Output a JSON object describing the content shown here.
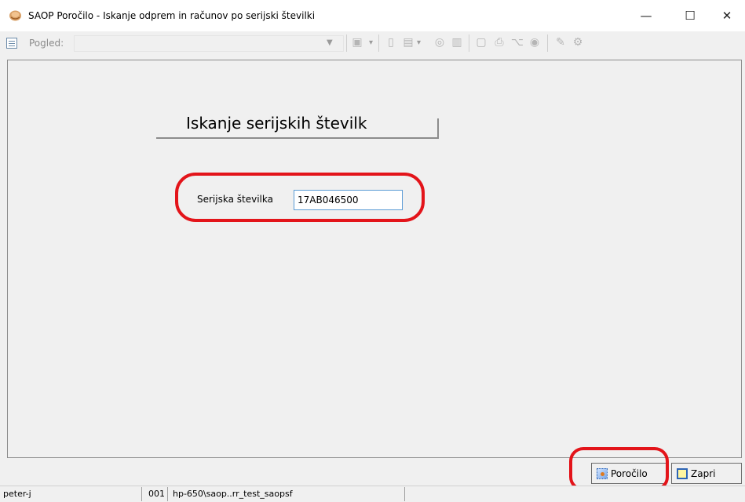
{
  "window": {
    "title": "SAOP Poročilo - Iskanje odprem in računov po serijski številki",
    "minimize": "—",
    "maximize": "☐",
    "close": "✕"
  },
  "toolbar": {
    "view_label": "Pogled:",
    "view_value": "",
    "icons": [
      "save-icon",
      "new-doc-icon",
      "export-icon",
      "refresh-icon",
      "chart-icon",
      "preview-icon",
      "print-icon",
      "pdf-icon",
      "database-icon",
      "edit-icon",
      "settings-icon"
    ]
  },
  "form": {
    "heading": "Iskanje serijskih številk",
    "serial_label": "Serijska številka",
    "serial_value": "17AB046500"
  },
  "buttons": {
    "report": "Poročilo",
    "close": "Zapri"
  },
  "statusbar": {
    "user": "peter-j",
    "code": "001",
    "database": "hp-650\\saop..rr_test_saopsf"
  },
  "colors": {
    "annotation": "#e3141a",
    "input_border": "#5b9bd5"
  }
}
